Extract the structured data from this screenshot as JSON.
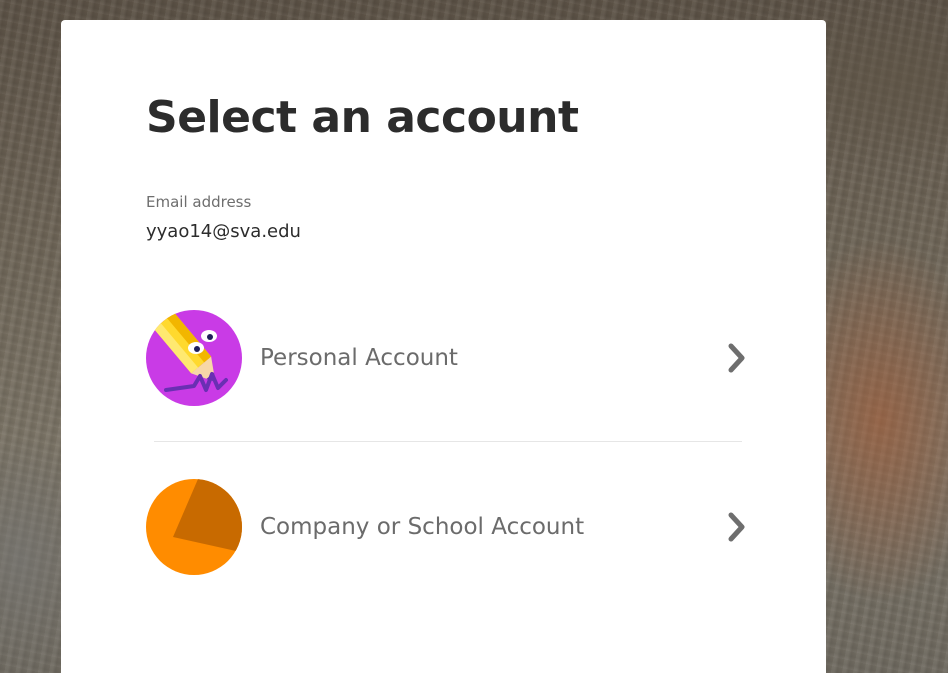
{
  "page": {
    "title": "Select an account",
    "email_label": "Email address",
    "email_value": "yyao14@sva.edu"
  },
  "accounts": [
    {
      "label": "Personal Account",
      "icon": "pencil-avatar-icon",
      "color": "#c93be6"
    },
    {
      "label": "Company or School Account",
      "icon": "building-avatar-icon",
      "color": "#ff8c00"
    }
  ],
  "colors": {
    "card": "#ffffff",
    "title": "#2c2c2c",
    "label": "#6b6b6b",
    "chevron": "#6e6e6e",
    "divider": "#e6e6e6"
  }
}
